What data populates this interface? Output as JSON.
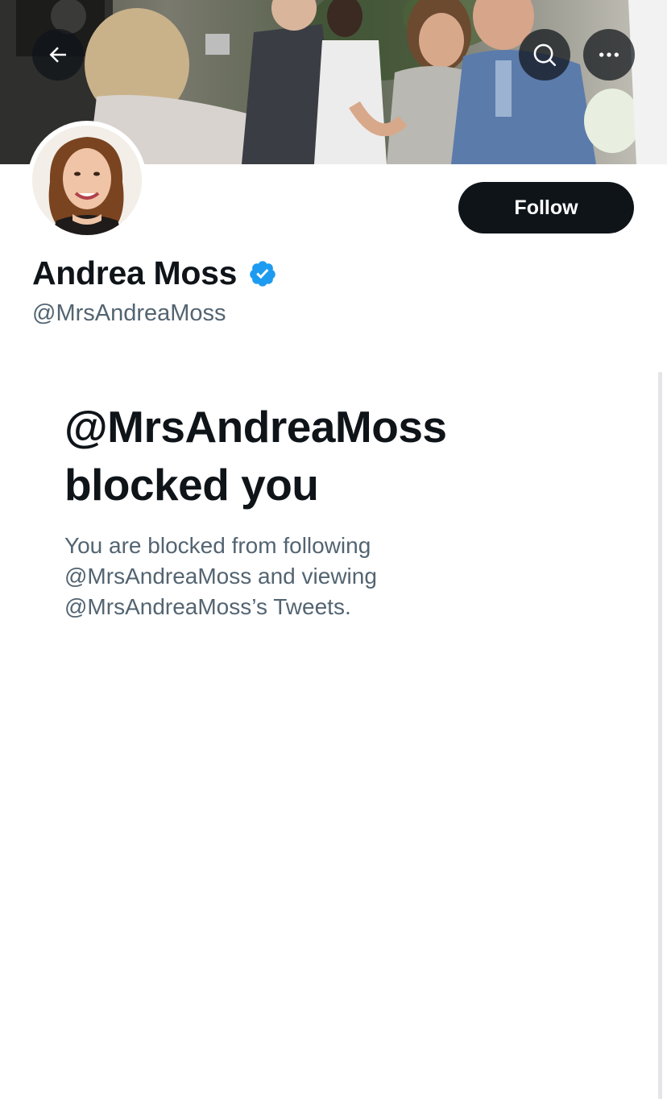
{
  "header": {
    "back_icon": "arrow-left-icon",
    "search_icon": "search-icon",
    "more_icon": "ellipsis-icon"
  },
  "profile": {
    "display_name": "Andrea Moss",
    "handle": "@MrsAndreaMoss",
    "verified": true,
    "verified_badge_icon": "verified-badge-icon",
    "follow_label": "Follow"
  },
  "blocked": {
    "title_line1": "@MrsAndreaMoss",
    "title_line2": "blocked you",
    "description_line1": "You are blocked from following",
    "description_line2": "@MrsAndreaMoss and viewing",
    "description_line3": "@MrsAndreaMoss’s Tweets."
  },
  "colors": {
    "primary_text": "#0f1419",
    "secondary_text": "#536471",
    "verified_blue": "#1d9bf0",
    "button_dark": "#0f1419"
  }
}
